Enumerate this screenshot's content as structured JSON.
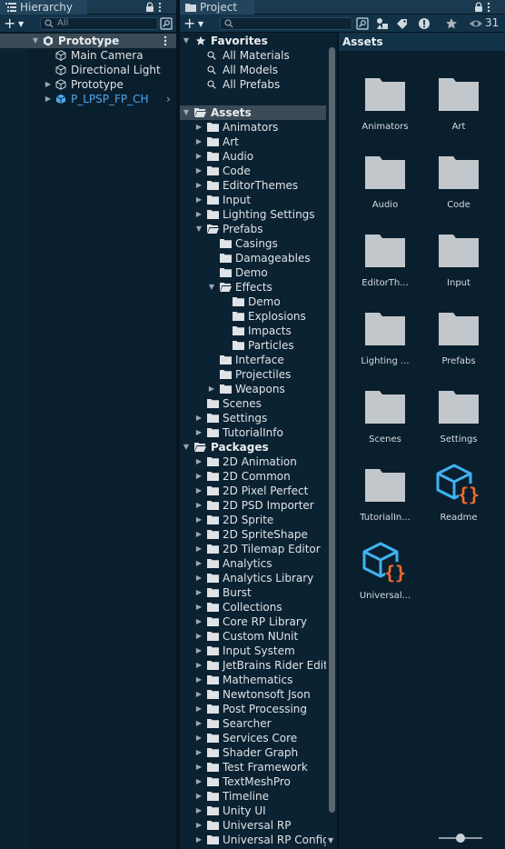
{
  "hierarchy": {
    "tab_label": "Hierarchy",
    "search_placeholder": "All",
    "scene": "Prototype",
    "items": [
      {
        "label": "Main Camera",
        "type": "gameobject"
      },
      {
        "label": "Directional Light",
        "type": "gameobject"
      },
      {
        "label": "Prototype",
        "type": "gameobject",
        "collapsed": true
      },
      {
        "label": "P_LPSP_FP_CH",
        "type": "prefab",
        "collapsed": true
      }
    ]
  },
  "project": {
    "tab_label": "Project",
    "hidden_packages_count": "31",
    "favorites": {
      "label": "Favorites",
      "items": [
        "All Materials",
        "All Models",
        "All Prefabs"
      ]
    },
    "assets": {
      "label": "Assets",
      "children": [
        "Animators",
        "Art",
        "Audio",
        "Code",
        "EditorThemes",
        "Input",
        "Lighting Settings"
      ],
      "prefabs": {
        "label": "Prefabs",
        "children": [
          "Casings",
          "Damageables",
          "Demo"
        ],
        "effects": {
          "label": "Effects",
          "children": [
            "Demo",
            "Explosions",
            "Impacts",
            "Particles"
          ]
        },
        "after_effects": [
          "Interface",
          "Projectiles",
          "Weapons"
        ]
      },
      "after_prefabs": [
        "Scenes",
        "Settings",
        "TutorialInfo"
      ]
    },
    "packages": {
      "label": "Packages",
      "children": [
        "2D Animation",
        "2D Common",
        "2D Pixel Perfect",
        "2D PSD Importer",
        "2D Sprite",
        "2D SpriteShape",
        "2D Tilemap Editor",
        "Analytics",
        "Analytics Library",
        "Burst",
        "Collections",
        "Core RP Library",
        "Custom NUnit",
        "Input System",
        "JetBrains Rider Editor",
        "Mathematics",
        "Newtonsoft Json",
        "Post Processing",
        "Searcher",
        "Services Core",
        "Shader Graph",
        "Test Framework",
        "TextMeshPro",
        "Timeline",
        "Unity UI",
        "Universal RP",
        "Universal RP Config"
      ]
    },
    "grid": {
      "header": "Assets",
      "items": [
        {
          "label": "Animators",
          "kind": "folder"
        },
        {
          "label": "Art",
          "kind": "folder"
        },
        {
          "label": "Audio",
          "kind": "folder"
        },
        {
          "label": "Code",
          "kind": "folder"
        },
        {
          "label": "EditorTh...",
          "kind": "folder"
        },
        {
          "label": "Input",
          "kind": "folder"
        },
        {
          "label": "Lighting ...",
          "kind": "folder"
        },
        {
          "label": "Prefabs",
          "kind": "folder"
        },
        {
          "label": "Scenes",
          "kind": "folder"
        },
        {
          "label": "Settings",
          "kind": "folder"
        },
        {
          "label": "TutorialIn...",
          "kind": "folder"
        },
        {
          "label": "Readme",
          "kind": "script-asset"
        },
        {
          "label": "Universal...",
          "kind": "script-asset"
        }
      ]
    },
    "zoom": 0.5
  },
  "colors": {
    "prefab_blue": "#4fa8ee",
    "folder_gray": "#c2c7cb",
    "asset_cyan": "#3fb3f0",
    "asset_orange": "#f26b2d",
    "selection": "#3a4b57"
  }
}
